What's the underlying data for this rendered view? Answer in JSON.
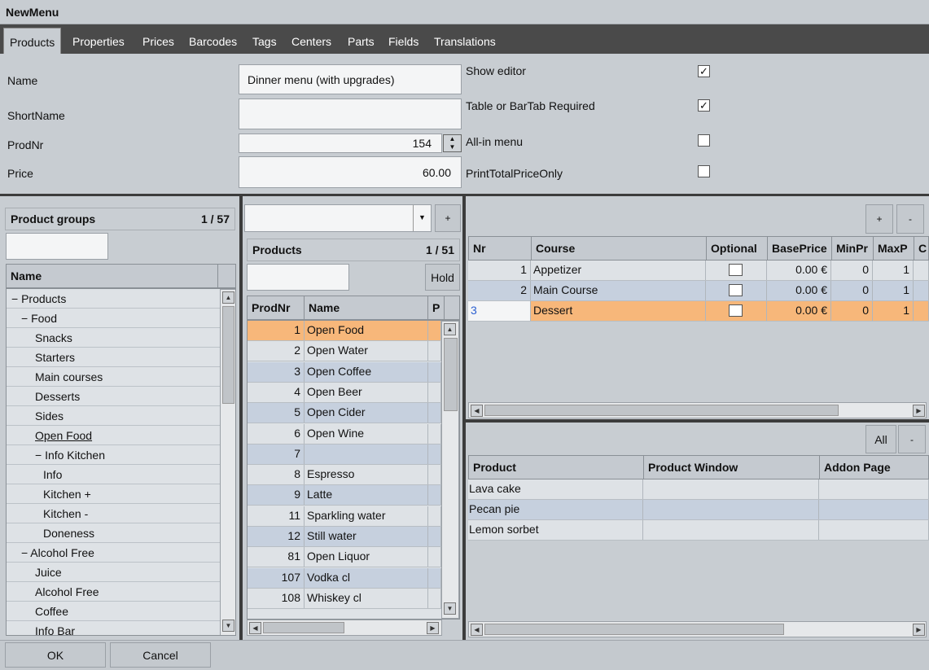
{
  "window": {
    "title": "NewMenu"
  },
  "tabs": [
    "Products",
    "Properties",
    "Prices",
    "Barcodes",
    "Tags",
    "Centers",
    "Parts",
    "Fields",
    "Translations"
  ],
  "form": {
    "name_label": "Name",
    "name_value": "Dinner menu (with upgrades)",
    "shortname_label": "ShortName",
    "shortname_value": "",
    "prodnr_label": "ProdNr",
    "prodnr_value": "154",
    "price_label": "Price",
    "price_value": "60.00",
    "show_editor_label": "Show editor",
    "show_editor_checked": true,
    "table_required_label": "Table or BarTab Required",
    "table_required_checked": true,
    "allin_label": "All-in menu",
    "allin_checked": false,
    "printtotal_label": "PrintTotalPriceOnly",
    "printtotal_checked": false
  },
  "product_groups": {
    "title": "Product groups",
    "counter": "1  /  57",
    "column": "Name",
    "items": [
      {
        "label": "− Products",
        "indent": 0
      },
      {
        "label": "− Food",
        "indent": 1
      },
      {
        "label": "Snacks",
        "indent": 2
      },
      {
        "label": "Starters",
        "indent": 2
      },
      {
        "label": "Main courses",
        "indent": 2
      },
      {
        "label": "Desserts",
        "indent": 2
      },
      {
        "label": "Sides",
        "indent": 2
      },
      {
        "label": "Open Food",
        "indent": 2
      },
      {
        "label": "− Info Kitchen",
        "indent": 2
      },
      {
        "label": "Info",
        "indent": 3
      },
      {
        "label": "Kitchen +",
        "indent": 3
      },
      {
        "label": "Kitchen -",
        "indent": 3
      },
      {
        "label": "Doneness",
        "indent": 3
      },
      {
        "label": "− Alcohol Free",
        "indent": 1
      },
      {
        "label": "Juice",
        "indent": 2
      },
      {
        "label": "Alcohol Free",
        "indent": 2
      },
      {
        "label": "Coffee",
        "indent": 2
      },
      {
        "label": "Info Bar",
        "indent": 2
      }
    ]
  },
  "products": {
    "title": "Products",
    "counter": "1  /  51",
    "hold_label": "Hold",
    "add_label": "+",
    "columns": [
      "ProdNr",
      "Name",
      "P"
    ],
    "rows": [
      {
        "nr": "1",
        "name": "Open Food"
      },
      {
        "nr": "2",
        "name": "Open Water"
      },
      {
        "nr": "3",
        "name": "Open Coffee"
      },
      {
        "nr": "4",
        "name": "Open Beer"
      },
      {
        "nr": "5",
        "name": "Open Cider"
      },
      {
        "nr": "6",
        "name": "Open Wine"
      },
      {
        "nr": "7",
        "name": ""
      },
      {
        "nr": "8",
        "name": "Espresso"
      },
      {
        "nr": "9",
        "name": "Latte"
      },
      {
        "nr": "11",
        "name": "Sparkling water"
      },
      {
        "nr": "12",
        "name": "Still water"
      },
      {
        "nr": "81",
        "name": "Open Liquor"
      },
      {
        "nr": "107",
        "name": "Vodka cl"
      },
      {
        "nr": "108",
        "name": "Whiskey cl"
      }
    ]
  },
  "courses": {
    "add_label": "+",
    "remove_label": "-",
    "columns": [
      "Nr",
      "Course",
      "Optional",
      "BasePrice",
      "MinPr",
      "MaxP",
      "C"
    ],
    "rows": [
      {
        "nr": "1",
        "course": "Appetizer",
        "base": "0.00 €",
        "min": "0",
        "max": "1"
      },
      {
        "nr": "2",
        "course": "Main Course",
        "base": "0.00 €",
        "min": "0",
        "max": "1"
      },
      {
        "nr": "3",
        "course": "Dessert",
        "base": "0.00 €",
        "min": "0",
        "max": "1"
      }
    ]
  },
  "course_products": {
    "all_label": "All",
    "remove_label": "-",
    "columns": [
      "Product",
      "Product Window",
      "Addon Page"
    ],
    "rows": [
      "Lava cake",
      "Pecan pie",
      "Lemon sorbet"
    ]
  },
  "footer": {
    "ok_label": "OK",
    "cancel_label": "Cancel"
  },
  "colors": {
    "selected": "#f7b77a",
    "row_alt": "#c6d0de",
    "row": "#dee2e6"
  }
}
